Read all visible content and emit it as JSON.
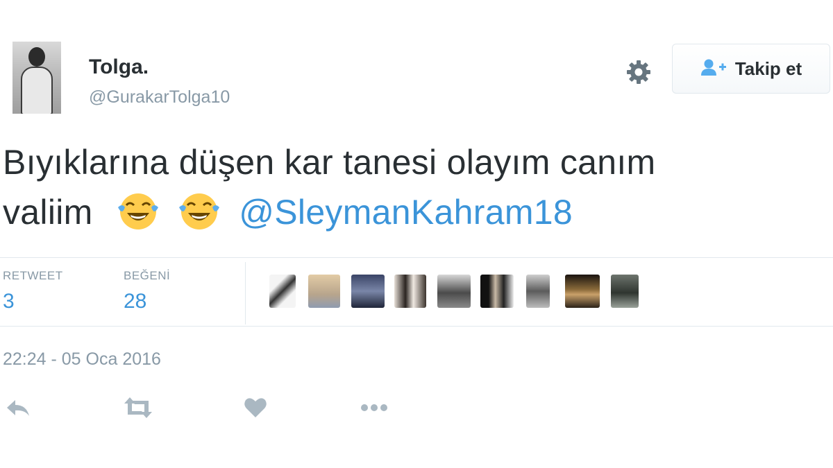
{
  "user": {
    "display_name": "Tolga.",
    "handle": "@GurakarTolga10"
  },
  "header": {
    "follow_label": "Takip et",
    "icons": {
      "settings": "gear-icon",
      "follow": "user-plus-icon"
    }
  },
  "tweet": {
    "text_line1": "Bıyıklarına düşen kar tanesi olayım canım",
    "text_line2": "valiim",
    "emojis": [
      "face-with-tears-of-joy",
      "face-with-tears-of-joy"
    ],
    "mention": "@SleymanKahram18"
  },
  "stats": {
    "retweet_label": "RETWEET",
    "retweet_count": "3",
    "like_label": "BEĞENİ",
    "like_count": "28",
    "likers": [
      "liker-1",
      "liker-2",
      "liker-3",
      "liker-4",
      "liker-5",
      "liker-6",
      "liker-7",
      "liker-8",
      "liker-9"
    ]
  },
  "timestamp": "22:24 - 05 Oca 2016",
  "actions": [
    "reply-icon",
    "retweet-icon",
    "like-icon",
    "more-icon"
  ],
  "colors": {
    "text": "#292f33",
    "muted": "#8899a6",
    "link": "#3b94d9",
    "border": "#e1e8ed",
    "action_icon": "#aab8c2"
  }
}
